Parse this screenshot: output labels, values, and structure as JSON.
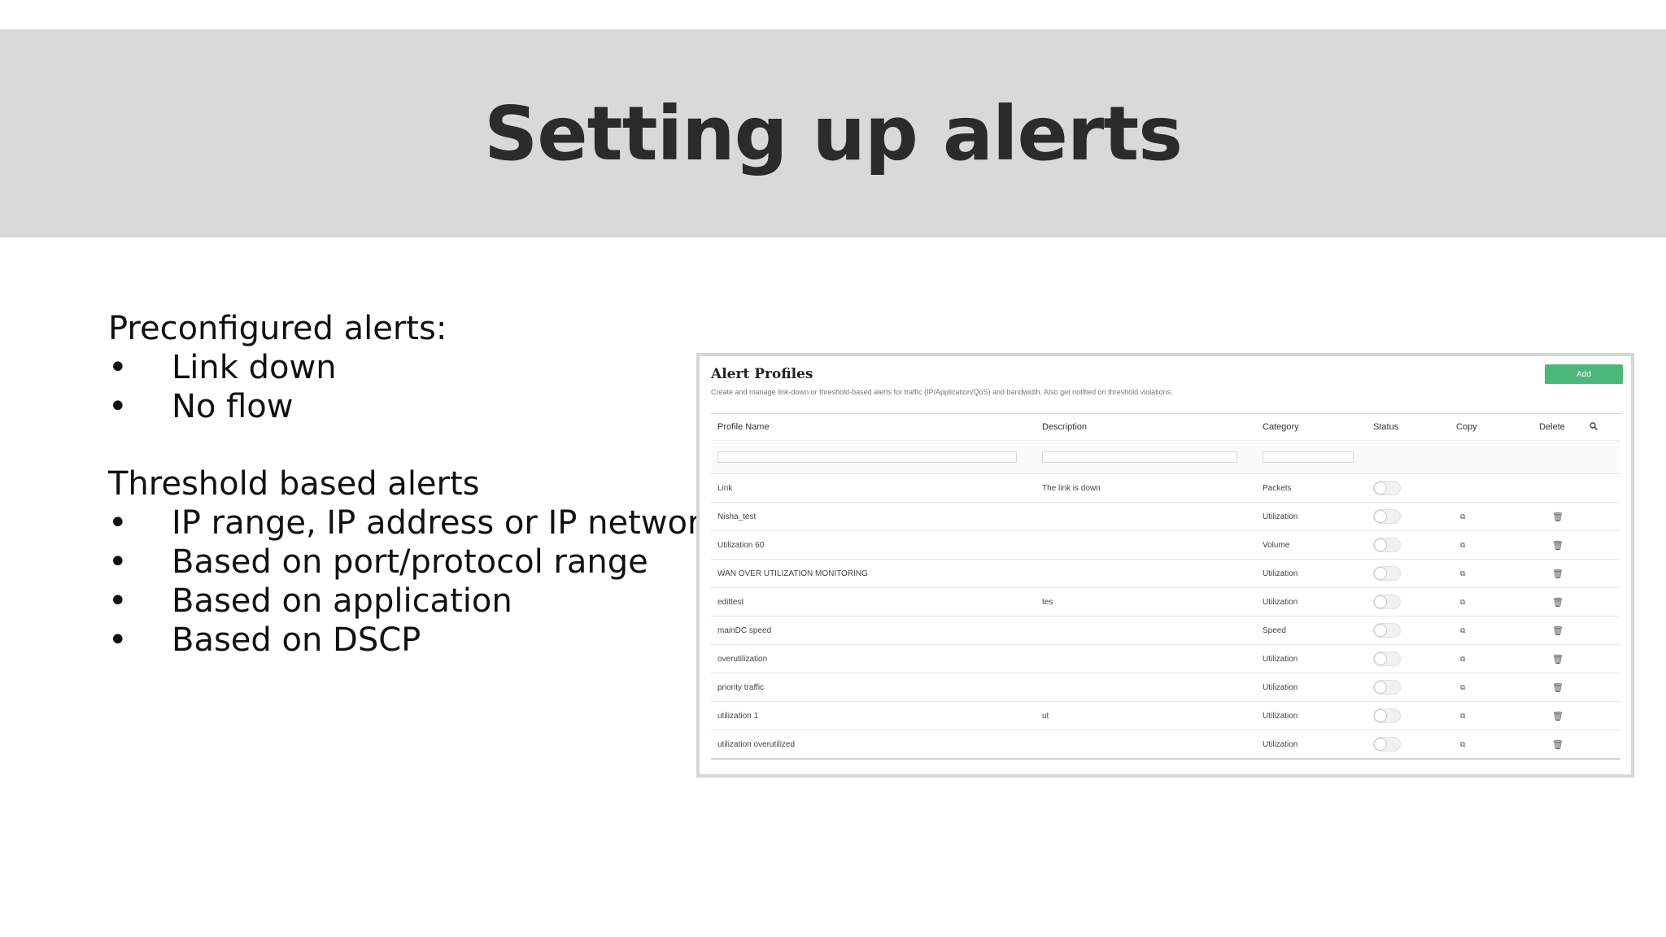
{
  "slide": {
    "title": "Setting up alerts",
    "preconfigured": {
      "heading": "Preconfigured alerts:",
      "bullet": "•",
      "items": [
        "Link down",
        "No flow"
      ]
    },
    "threshold": {
      "heading": "Threshold based alerts",
      "bullet": "•",
      "items": [
        "IP range, IP address or IP network",
        "Based on port/protocol range",
        "Based on application",
        "Based on DSCP"
      ]
    }
  },
  "panel": {
    "title": "Alert Profiles",
    "description": "Create and manage link-down or threshold-based alerts for traffic (IP/Application/QoS) and bandwidth. Also get notified on threshold violations.",
    "add_label": "Add",
    "add_color": "#4bb87a",
    "columns": [
      "Profile Name",
      "Description",
      "Category",
      "Status",
      "Copy",
      "Delete"
    ],
    "search_icon": "search-icon",
    "copy_icon": "copy-icon",
    "delete_icon": "trash-icon",
    "rows": [
      {
        "name": "Link",
        "description": "The link is down",
        "category": "Packets",
        "status": "off",
        "copy": false,
        "delete": false
      },
      {
        "name": "Nisha_test",
        "description": "",
        "category": "Utilization",
        "status": "off",
        "copy": true,
        "delete": true
      },
      {
        "name": "Utilization 60",
        "description": "",
        "category": "Volume",
        "status": "off",
        "copy": true,
        "delete": true
      },
      {
        "name": "WAN OVER UTILIZATION MONITORING",
        "description": "",
        "category": "Utilization",
        "status": "off",
        "copy": true,
        "delete": true
      },
      {
        "name": "edittest",
        "description": "tes",
        "category": "Utilization",
        "status": "off",
        "copy": true,
        "delete": true
      },
      {
        "name": "mainDC speed",
        "description": "",
        "category": "Speed",
        "status": "off",
        "copy": true,
        "delete": true
      },
      {
        "name": "overutilization",
        "description": "",
        "category": "Utilization",
        "status": "off",
        "copy": true,
        "delete": true
      },
      {
        "name": "priority traffic",
        "description": "",
        "category": "Utilization",
        "status": "off",
        "copy": true,
        "delete": true
      },
      {
        "name": "utilization 1",
        "description": "ut",
        "category": "Utilization",
        "status": "off",
        "copy": true,
        "delete": true
      },
      {
        "name": "utilization overutilized",
        "description": "",
        "category": "Utilization",
        "status": "off",
        "copy": true,
        "delete": true
      }
    ]
  }
}
